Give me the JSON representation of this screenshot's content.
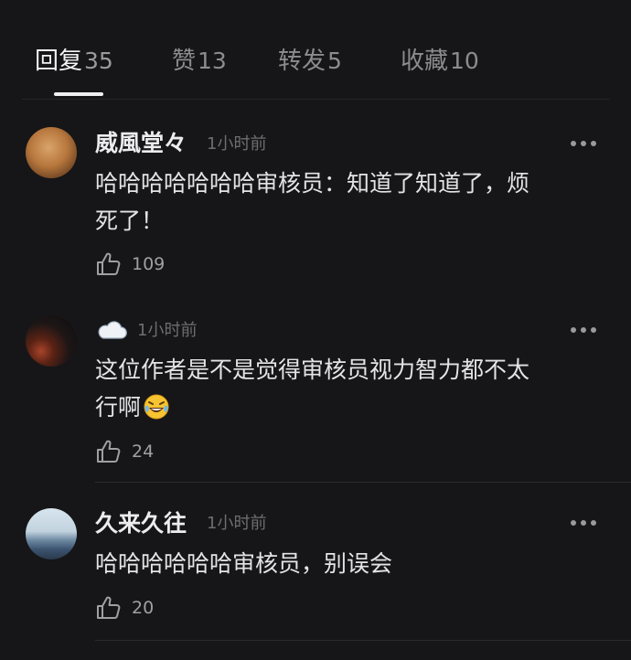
{
  "tabs": [
    {
      "label": "回复",
      "count": "35",
      "active": true
    },
    {
      "label": "赞",
      "count": "13",
      "active": false
    },
    {
      "label": "转发",
      "count": "5",
      "active": false
    },
    {
      "label": "收藏",
      "count": "10",
      "active": false
    }
  ],
  "comments": [
    {
      "username": "威風堂々",
      "time": "1小时前",
      "text": "哈哈哈哈哈哈哈审核员：知道了知道了，烦\n死了！",
      "likes": "109",
      "avatar_icon": "avatar-photo"
    },
    {
      "username_icon": "cloud-icon",
      "time": "1小时前",
      "text": "这位作者是不是觉得审核员视力智力都不太\n行啊",
      "trailing_emoji": "laughing-tears-emoji",
      "likes": "24",
      "avatar_icon": "avatar-photo"
    },
    {
      "username": "久来久往",
      "time": "1小时前",
      "text": "哈哈哈哈哈哈审核员，别误会",
      "likes": "20",
      "avatar_icon": "avatar-photo"
    }
  ],
  "colors": {
    "background": "#161618",
    "active_tab": "#f2f2f4",
    "inactive_tab": "#8c8c90",
    "muted_text": "#6e6e72"
  }
}
